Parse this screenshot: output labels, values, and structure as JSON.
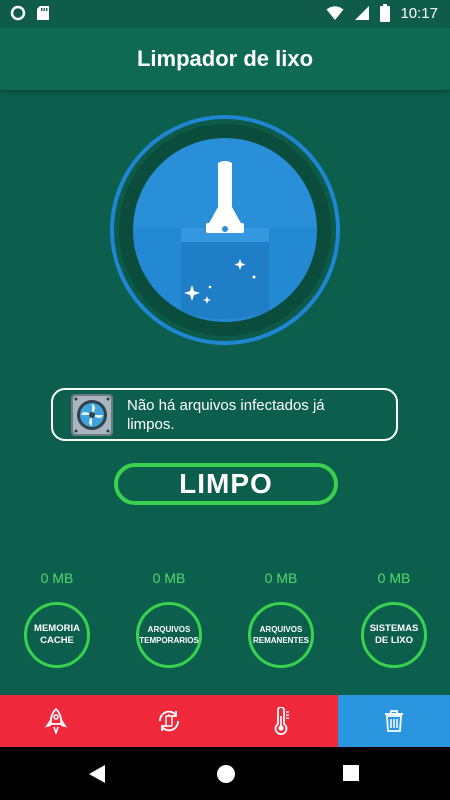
{
  "status_bar": {
    "time": "10:17"
  },
  "app_bar": {
    "title": "Limpador de lixo"
  },
  "info_box": {
    "message": "Não há arquivos infectados já limpos."
  },
  "status_button": {
    "label": "LIMPO"
  },
  "categories": [
    {
      "size": "0 MB",
      "label": "MEMORIA CACHE"
    },
    {
      "size": "0 MB",
      "label": "ARQUIVOS TEMPORARIOS"
    },
    {
      "size": "0 MB",
      "label": "ARQUIVOS REMANENTES"
    },
    {
      "size": "0 MB",
      "label": "SISTEMAS DE LIXO"
    }
  ],
  "tabs": [
    {
      "icon": "rocket-icon",
      "active": false
    },
    {
      "icon": "battery-refresh-icon",
      "active": false
    },
    {
      "icon": "thermometer-icon",
      "active": false
    },
    {
      "icon": "trash-icon",
      "active": true
    }
  ],
  "colors": {
    "background": "#0d5f4d",
    "accent_green": "#39d24e",
    "tab_red": "#f0283c",
    "tab_active_blue": "#2a96e0"
  }
}
